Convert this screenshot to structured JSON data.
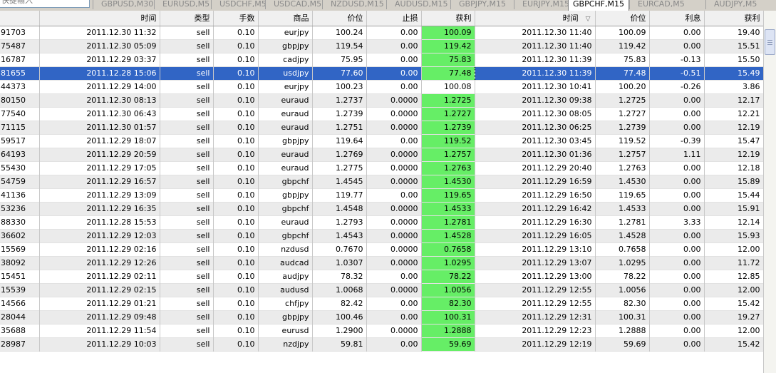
{
  "search": {
    "placeholder": "快捷输入"
  },
  "tabs": [
    {
      "label": "GBPUSD,M30"
    },
    {
      "label": "EURUSD,M5"
    },
    {
      "label": "USDCHF,M5"
    },
    {
      "label": "USDCAD,M5"
    },
    {
      "label": "NZDUSD,M15"
    },
    {
      "label": "AUDUSD,M15"
    },
    {
      "label": "GBPJPY,M15"
    },
    {
      "label": "EURJPY,M15"
    },
    {
      "label": "GBPCHF,M15",
      "active": true
    },
    {
      "label": "EURCAD,M5"
    },
    {
      "label": "AUDJPY,M5"
    }
  ],
  "table": {
    "headers": [
      "",
      "时间",
      "类型",
      "手数",
      "商品",
      "价位",
      "止损",
      "获利",
      "时间",
      "价位",
      "利息",
      "获利"
    ],
    "sort_indicator": "▽",
    "rows": [
      [
        "91703",
        "2011.12.30 11:32",
        "sell",
        "0.10",
        "eurjpy",
        "100.24",
        "0.00",
        "100.09",
        "2011.12.30 11:40",
        "100.09",
        "0.00",
        "19.40"
      ],
      [
        "75487",
        "2011.12.30 05:09",
        "sell",
        "0.10",
        "gbpjpy",
        "119.54",
        "0.00",
        "119.42",
        "2011.12.30 11:40",
        "119.42",
        "0.00",
        "15.51"
      ],
      [
        "16787",
        "2011.12.29 03:37",
        "sell",
        "0.10",
        "cadjpy",
        "75.95",
        "0.00",
        "75.83",
        "2011.12.30 11:39",
        "75.83",
        "-0.13",
        "15.50"
      ],
      [
        "81655",
        "2011.12.28 15:06",
        "sell",
        "0.10",
        "usdjpy",
        "77.60",
        "0.00",
        "77.48",
        "2011.12.30 11:39",
        "77.48",
        "-0.51",
        "15.49"
      ],
      [
        "44373",
        "2011.12.29 14:00",
        "sell",
        "0.10",
        "eurjpy",
        "100.23",
        "0.00",
        "100.08",
        "2011.12.30 10:41",
        "100.20",
        "-0.26",
        "3.86"
      ],
      [
        "80150",
        "2011.12.30 08:13",
        "sell",
        "0.10",
        "euraud",
        "1.2737",
        "0.0000",
        "1.2725",
        "2011.12.30 09:38",
        "1.2725",
        "0.00",
        "12.17"
      ],
      [
        "77540",
        "2011.12.30 06:43",
        "sell",
        "0.10",
        "euraud",
        "1.2739",
        "0.0000",
        "1.2727",
        "2011.12.30 08:05",
        "1.2727",
        "0.00",
        "12.21"
      ],
      [
        "71115",
        "2011.12.30 01:57",
        "sell",
        "0.10",
        "euraud",
        "1.2751",
        "0.0000",
        "1.2739",
        "2011.12.30 06:25",
        "1.2739",
        "0.00",
        "12.19"
      ],
      [
        "59517",
        "2011.12.29 18:07",
        "sell",
        "0.10",
        "gbpjpy",
        "119.64",
        "0.00",
        "119.52",
        "2011.12.30 03:45",
        "119.52",
        "-0.39",
        "15.47"
      ],
      [
        "64193",
        "2011.12.29 20:59",
        "sell",
        "0.10",
        "euraud",
        "1.2769",
        "0.0000",
        "1.2757",
        "2011.12.30 01:36",
        "1.2757",
        "1.11",
        "12.19"
      ],
      [
        "55430",
        "2011.12.29 17:05",
        "sell",
        "0.10",
        "euraud",
        "1.2775",
        "0.0000",
        "1.2763",
        "2011.12.29 20:40",
        "1.2763",
        "0.00",
        "12.18"
      ],
      [
        "54759",
        "2011.12.29 16:57",
        "sell",
        "0.10",
        "gbpchf",
        "1.4545",
        "0.0000",
        "1.4530",
        "2011.12.29 16:59",
        "1.4530",
        "0.00",
        "15.89"
      ],
      [
        "41136",
        "2011.12.29 13:09",
        "sell",
        "0.10",
        "gbpjpy",
        "119.77",
        "0.00",
        "119.65",
        "2011.12.29 16:50",
        "119.65",
        "0.00",
        "15.44"
      ],
      [
        "53236",
        "2011.12.29 16:35",
        "sell",
        "0.10",
        "gbpchf",
        "1.4548",
        "0.0000",
        "1.4533",
        "2011.12.29 16:42",
        "1.4533",
        "0.00",
        "15.91"
      ],
      [
        "88330",
        "2011.12.28 15:53",
        "sell",
        "0.10",
        "euraud",
        "1.2793",
        "0.0000",
        "1.2781",
        "2011.12.29 16:30",
        "1.2781",
        "3.33",
        "12.14"
      ],
      [
        "36602",
        "2011.12.29 12:03",
        "sell",
        "0.10",
        "gbpchf",
        "1.4543",
        "0.0000",
        "1.4528",
        "2011.12.29 16:05",
        "1.4528",
        "0.00",
        "15.93"
      ],
      [
        "15569",
        "2011.12.29 02:16",
        "sell",
        "0.10",
        "nzdusd",
        "0.7670",
        "0.0000",
        "0.7658",
        "2011.12.29 13:10",
        "0.7658",
        "0.00",
        "12.00"
      ],
      [
        "38092",
        "2011.12.29 12:26",
        "sell",
        "0.10",
        "audcad",
        "1.0307",
        "0.0000",
        "1.0295",
        "2011.12.29 13:07",
        "1.0295",
        "0.00",
        "11.72"
      ],
      [
        "15451",
        "2011.12.29 02:11",
        "sell",
        "0.10",
        "audjpy",
        "78.32",
        "0.00",
        "78.22",
        "2011.12.29 13:00",
        "78.22",
        "0.00",
        "12.85"
      ],
      [
        "15539",
        "2011.12.29 02:15",
        "sell",
        "0.10",
        "audusd",
        "1.0068",
        "0.0000",
        "1.0056",
        "2011.12.29 12:55",
        "1.0056",
        "0.00",
        "12.00"
      ],
      [
        "14566",
        "2011.12.29 01:21",
        "sell",
        "0.10",
        "chfjpy",
        "82.42",
        "0.00",
        "82.30",
        "2011.12.29 12:55",
        "82.30",
        "0.00",
        "15.42"
      ],
      [
        "28044",
        "2011.12.29 09:48",
        "sell",
        "0.10",
        "gbpjpy",
        "100.46",
        "0.00",
        "100.31",
        "2011.12.29 12:31",
        "100.31",
        "0.00",
        "19.27"
      ],
      [
        "35688",
        "2011.12.29 11:54",
        "sell",
        "0.10",
        "eurusd",
        "1.2900",
        "0.0000",
        "1.2888",
        "2011.12.29 12:23",
        "1.2888",
        "0.00",
        "12.00"
      ],
      [
        "28987",
        "2011.12.29 10:03",
        "sell",
        "0.10",
        "nzdjpy",
        "59.81",
        "0.00",
        "59.69",
        "2011.12.29 12:19",
        "59.69",
        "0.00",
        "15.42"
      ]
    ],
    "selected_row": 3,
    "plain_tp_rows": [
      4
    ]
  },
  "colors": {
    "take_profit_highlight": "#66ee66",
    "selection": "#3165c5",
    "alt_row": "#ebebeb"
  }
}
